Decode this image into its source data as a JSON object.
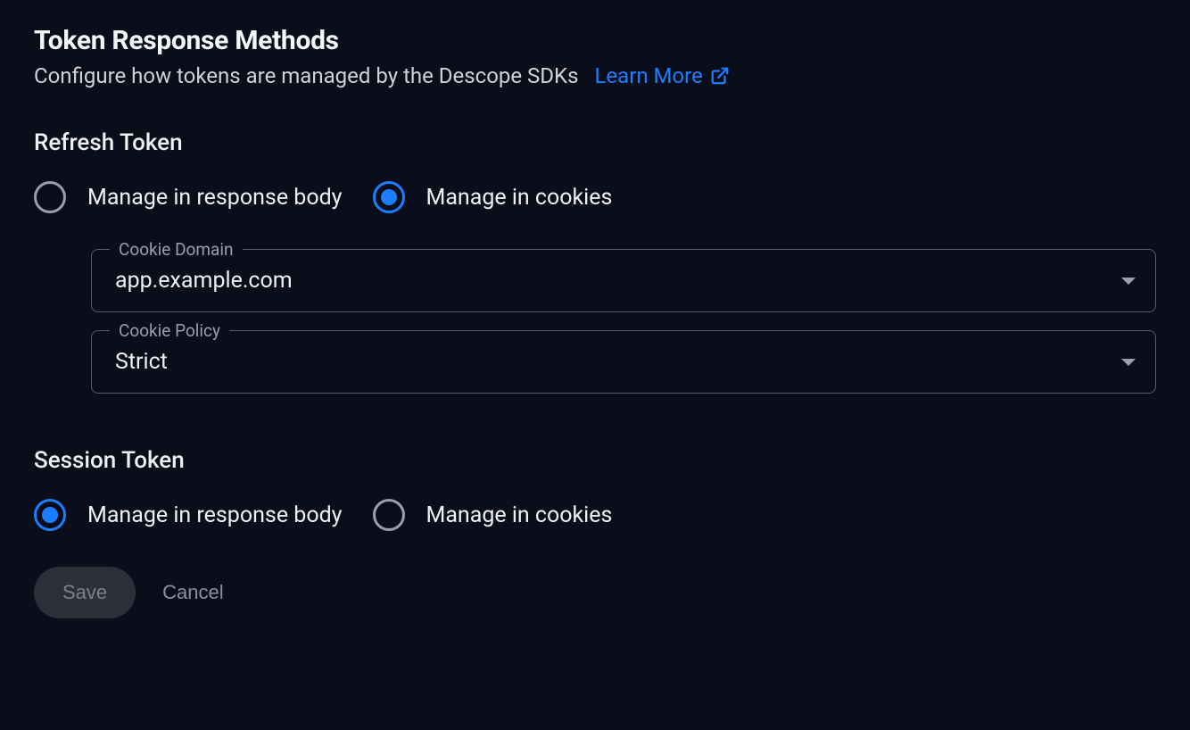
{
  "header": {
    "title": "Token Response Methods",
    "subtitle": "Configure how tokens are managed by the Descope SDKs",
    "learn_more_label": "Learn More"
  },
  "refresh_token": {
    "heading": "Refresh Token",
    "option_body": "Manage in response body",
    "option_cookies": "Manage in cookies",
    "selected": "cookies",
    "cookie_domain": {
      "label": "Cookie Domain",
      "value": "app.example.com"
    },
    "cookie_policy": {
      "label": "Cookie Policy",
      "value": "Strict"
    }
  },
  "session_token": {
    "heading": "Session Token",
    "option_body": "Manage in response body",
    "option_cookies": "Manage in cookies",
    "selected": "body"
  },
  "actions": {
    "save": "Save",
    "cancel": "Cancel"
  }
}
